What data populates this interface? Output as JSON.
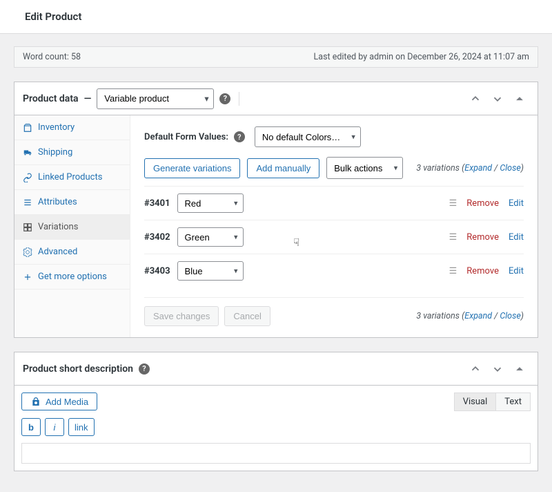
{
  "header": {
    "title": "Edit Product"
  },
  "editor_info": {
    "word_count_label": "Word count: 58",
    "last_edited": "Last edited by admin on December 26, 2024 at 11:07 am"
  },
  "product_data": {
    "heading": "Product data",
    "dash": "—",
    "product_type": "Variable product",
    "tabs": [
      {
        "label": "Inventory",
        "icon": "inventory-icon"
      },
      {
        "label": "Shipping",
        "icon": "shipping-icon"
      },
      {
        "label": "Linked Products",
        "icon": "linked-icon"
      },
      {
        "label": "Attributes",
        "icon": "attributes-icon"
      },
      {
        "label": "Variations",
        "icon": "variations-icon"
      },
      {
        "label": "Advanced",
        "icon": "advanced-icon"
      },
      {
        "label": "Get more options",
        "icon": "plus-icon"
      }
    ],
    "variations_panel": {
      "default_label": "Default Form Values:",
      "default_select": "No default Colors…",
      "buttons": {
        "generate": "Generate variations",
        "add_manual": "Add manually",
        "bulk": "Bulk actions"
      },
      "summary_count": "3 variations",
      "summary_paren_open": " (",
      "summary_expand": "Expand",
      "summary_sep": " / ",
      "summary_close": "Close",
      "summary_paren_close": ")",
      "rows": [
        {
          "id": "#3401",
          "color": "Red"
        },
        {
          "id": "#3402",
          "color": "Green"
        },
        {
          "id": "#3403",
          "color": "Blue"
        }
      ],
      "row_actions": {
        "remove": "Remove",
        "edit": "Edit"
      },
      "footer": {
        "save": "Save changes",
        "cancel": "Cancel"
      }
    }
  },
  "short_desc": {
    "heading": "Product short description",
    "add_media": "Add Media",
    "tabs": {
      "visual": "Visual",
      "text": "Text"
    },
    "ql": {
      "b": "b",
      "i": "i",
      "link": "link"
    }
  },
  "icons": {
    "help": "?"
  }
}
